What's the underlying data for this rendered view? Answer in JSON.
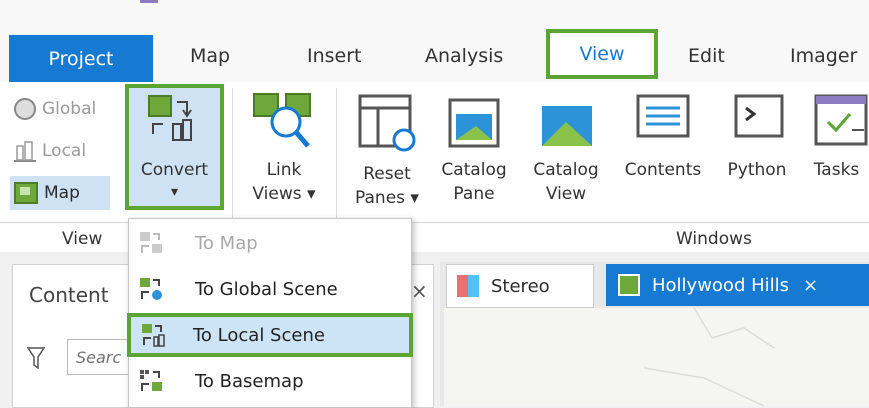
{
  "tabs": [
    {
      "label": "Project"
    },
    {
      "label": "Map"
    },
    {
      "label": "Insert"
    },
    {
      "label": "Analysis"
    },
    {
      "label": "View"
    },
    {
      "label": "Edit"
    },
    {
      "label": "Imager"
    }
  ],
  "ribbon": {
    "view_group": {
      "label": "View",
      "global_label": "Global",
      "local_label": "Local",
      "map_label": "Map",
      "convert_label": "Convert",
      "convert_arrow": "▾"
    },
    "link": {
      "label_line1": "Link",
      "label_line2": "Views ▾"
    },
    "windows_group": {
      "label": "Windows",
      "reset_line1": "Reset",
      "reset_line2": "Panes ▾",
      "catpane_line1": "Catalog",
      "catpane_line2": "Pane",
      "catview_line1": "Catalog",
      "catview_line2": "View",
      "contents": "Contents",
      "python": "Python",
      "tasks": "Tasks"
    }
  },
  "convert_menu": {
    "items": [
      {
        "label": "To Map",
        "state": "disabled"
      },
      {
        "label": "To Global Scene",
        "state": "normal"
      },
      {
        "label": "To Local Scene",
        "state": "selected"
      },
      {
        "label": "To Basemap",
        "state": "normal"
      }
    ]
  },
  "contents_pane": {
    "title": "Content",
    "close": "×",
    "search_placeholder": "Searc"
  },
  "view_tabs": [
    {
      "label": "Stereo"
    },
    {
      "label": "Hollywood Hills",
      "close": "×"
    }
  ],
  "colors": {
    "accent_blue": "#1679d2",
    "highlight_green": "#5ba534",
    "convert_bg": "#cfe2f3"
  }
}
